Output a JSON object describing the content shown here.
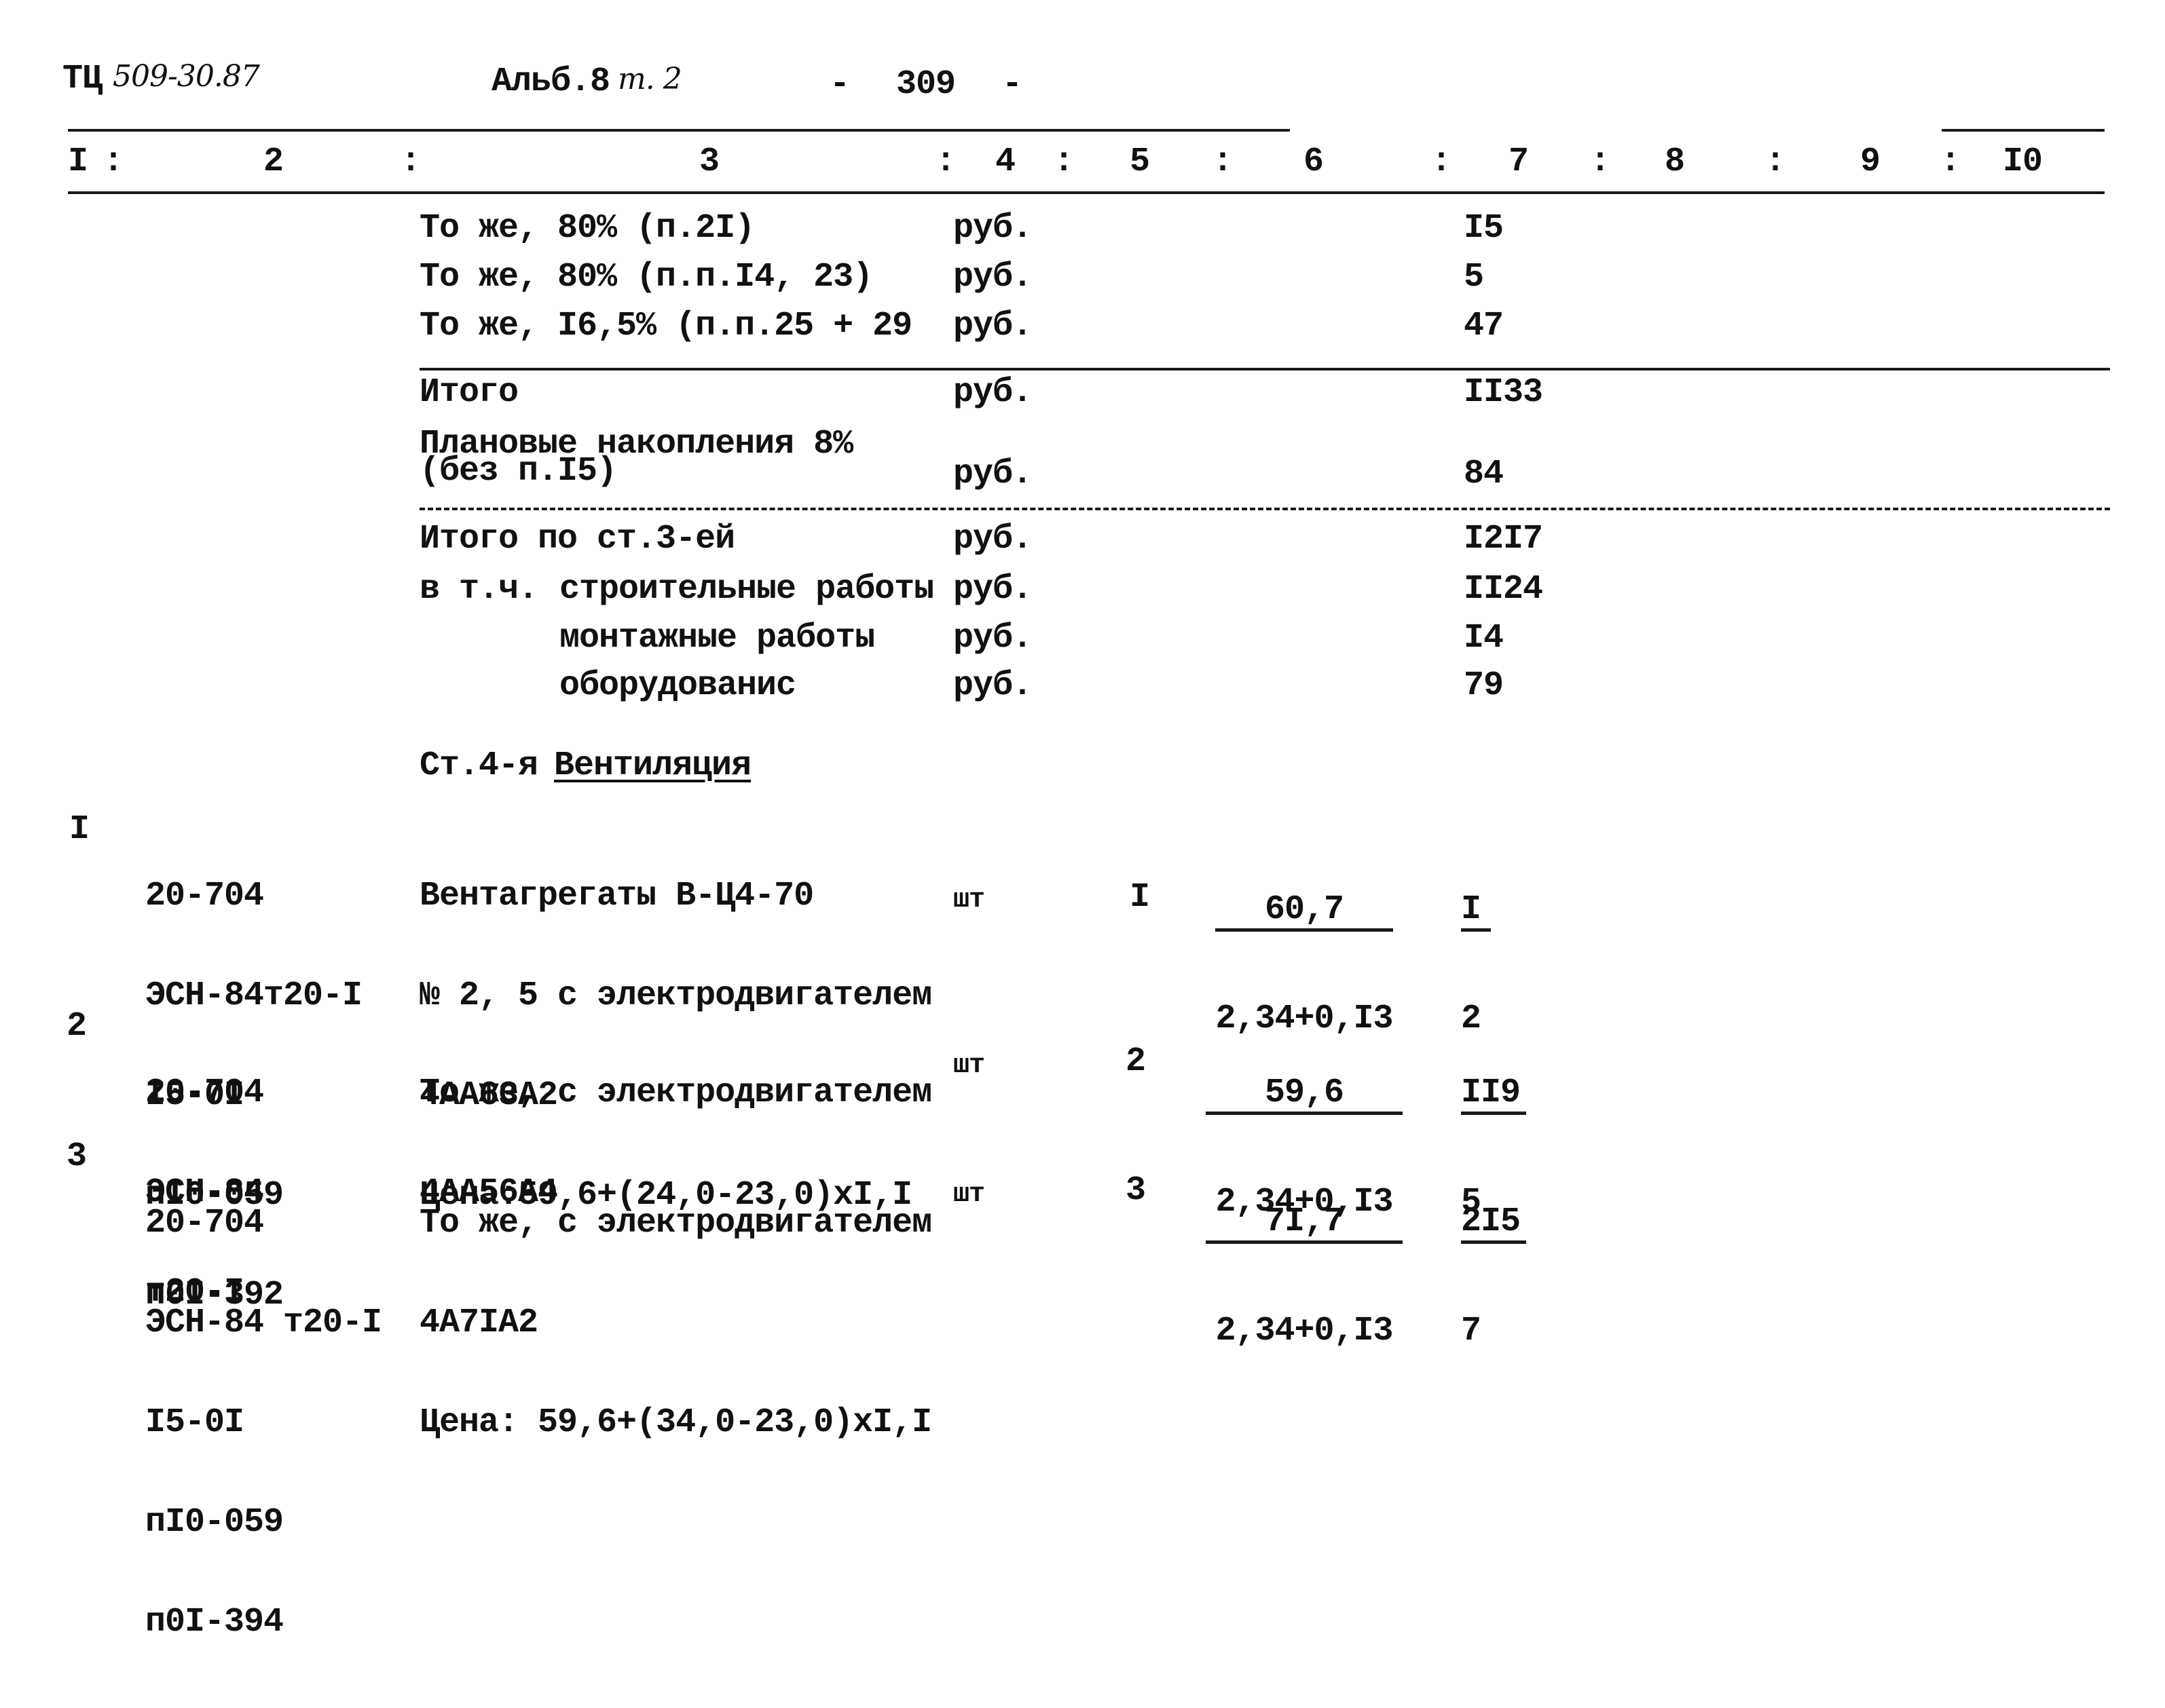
{
  "header": {
    "code_prefix": "ТЦ",
    "code_handwritten": "509-30.87",
    "album_label": "Альб.8",
    "album_part_handwritten": "т. 2",
    "page_number": "- 309 -"
  },
  "column_headers": [
    "I",
    "2",
    "3",
    "4",
    "5",
    "6",
    "7",
    "8",
    "9",
    "I0"
  ],
  "column_separator": ":",
  "summary_rows": [
    {
      "description": "То же, 80% (п.2I)",
      "unit": "руб.",
      "col7": "I5"
    },
    {
      "description": "То же, 80% (п.п.I4, 23)",
      "unit": "руб.",
      "col7": "5"
    },
    {
      "description": "То же, I6,5% (п.п.25 + 29",
      "unit": "руб.",
      "col7": "47"
    },
    {
      "description": "Итого",
      "unit": "руб.",
      "col7": "II33"
    },
    {
      "description_line1": "Плановые накопления 8%",
      "description_line2": "(без п.I5)",
      "unit": "руб.",
      "col7": "84"
    },
    {
      "description": "Итого по ст.3-ей",
      "unit": "руб.",
      "col7": "I2I7"
    },
    {
      "prefix": "в т.ч.",
      "description": "строительные работы",
      "unit": "руб.",
      "col7": "II24"
    },
    {
      "description": "монтажные работы",
      "unit": "руб.",
      "col7": "I4"
    },
    {
      "description": "оборудованис",
      "unit": "руб.",
      "col7": "79"
    }
  ],
  "section": {
    "prefix": "Ст.4-я",
    "title": "Вентиляция"
  },
  "items": [
    {
      "num": "I",
      "codes": [
        "20-704",
        "ЭСН-84т20-I",
        "I5-0I",
        "пI0-059",
        "п0I-392"
      ],
      "description": [
        "Вентагрегаты В-Ц4-70",
        "№ 2, 5 с электродвигателем",
        "4АА63А2",
        "Цена:59,6+(24,0-23,0)xI,I"
      ],
      "unit": "шт",
      "qty": "I",
      "price_num": "60,7",
      "price_den": "2,34+0,I3",
      "total_num": "I",
      "total_den": "2"
    },
    {
      "num": "2",
      "codes": [
        "20-704",
        "ЭСН-84",
        "т20-I"
      ],
      "description": [
        "То же, с электродвигателем",
        "4АА56А4"
      ],
      "unit": "шт",
      "qty": "2",
      "price_num": "59,6",
      "price_den": "2,34+0,I3",
      "total_num": "II9",
      "total_den": "5"
    },
    {
      "num": "3",
      "codes": [
        "20-704",
        "ЭСН-84 т20-I",
        "I5-0I",
        "пI0-059",
        "п0I-394"
      ],
      "description": [
        "То же, с электродвигателем",
        "4А7IА2",
        "Цена: 59,6+(34,0-23,0)xI,I"
      ],
      "unit": "шт",
      "qty": "3",
      "price_num": "7I,7",
      "price_den": "2,34+0,I3",
      "total_num": "2I5",
      "total_den": "7"
    }
  ]
}
